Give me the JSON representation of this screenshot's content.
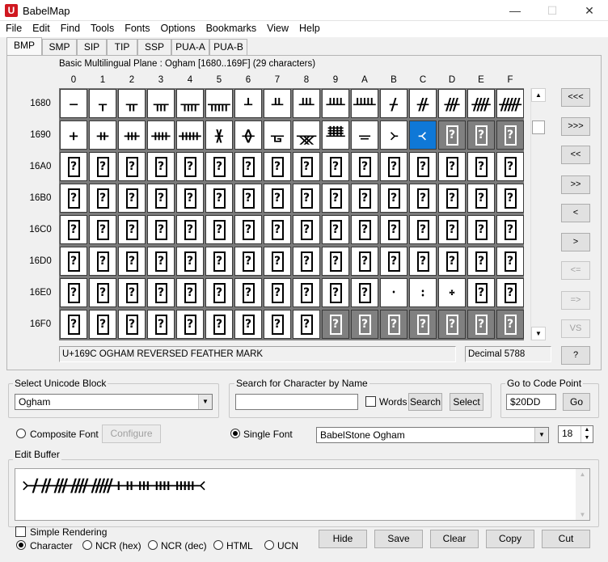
{
  "window": {
    "title": "BabelMap",
    "app_icon": "U",
    "controls": [
      "—",
      "☐",
      "✕"
    ]
  },
  "menu": [
    "File",
    "Edit",
    "Find",
    "Tools",
    "Fonts",
    "Options",
    "Bookmarks",
    "View",
    "Help"
  ],
  "tabs": [
    "BMP",
    "SMP",
    "SIP",
    "TIP",
    "SSP",
    "PUA-A",
    "PUA-B"
  ],
  "plane_label": "Basic Multilingual Plane : Ogham [1680..169F] (29 characters)",
  "column_headers": [
    "0",
    "1",
    "2",
    "3",
    "4",
    "5",
    "6",
    "7",
    "8",
    "9",
    "A",
    "B",
    "C",
    "D",
    "E",
    "F"
  ],
  "row_headers": [
    "1680",
    "1690",
    "16A0",
    "16B0",
    "16C0",
    "16D0",
    "16E0",
    "16F0"
  ],
  "rows": [
    [
      " ",
      "ᚁ",
      "ᚂ",
      "ᚃ",
      "ᚄ",
      "ᚅ",
      "ᚆ",
      "ᚇ",
      "ᚈ",
      "ᚉ",
      "ᚊ",
      "ᚋ",
      "ᚌ",
      "ᚍ",
      "ᚎ",
      "ᚏ"
    ],
    [
      "ᚐ",
      "ᚑ",
      "ᚒ",
      "ᚓ",
      "ᚔ",
      "ᚕ",
      "ᚖ",
      "ᚗ",
      "ᚘ",
      "ᚙ",
      "ᚚ",
      "᚛",
      "᚜",
      "?",
      "?",
      "?"
    ],
    [
      "?",
      "?",
      "?",
      "?",
      "?",
      "?",
      "?",
      "?",
      "?",
      "?",
      "?",
      "?",
      "?",
      "?",
      "?",
      "?"
    ],
    [
      "?",
      "?",
      "?",
      "?",
      "?",
      "?",
      "?",
      "?",
      "?",
      "?",
      "?",
      "?",
      "?",
      "?",
      "?",
      "?"
    ],
    [
      "?",
      "?",
      "?",
      "?",
      "?",
      "?",
      "?",
      "?",
      "?",
      "?",
      "?",
      "?",
      "?",
      "?",
      "?",
      "?"
    ],
    [
      "?",
      "?",
      "?",
      "?",
      "?",
      "?",
      "?",
      "?",
      "?",
      "?",
      "?",
      "?",
      "?",
      "?",
      "?",
      "?"
    ],
    [
      "?",
      "?",
      "?",
      "?",
      "?",
      "?",
      "?",
      "?",
      "?",
      "?",
      "?",
      "᛫",
      "᛬",
      "᛭",
      "?",
      "?"
    ],
    [
      "?",
      "?",
      "?",
      "?",
      "?",
      "?",
      "?",
      "?",
      "?",
      "?",
      "?",
      "?",
      "?",
      "?",
      "?",
      "?"
    ]
  ],
  "nav_buttons": [
    "<<<",
    ">>>",
    "<<",
    ">>",
    "<",
    ">",
    "<=",
    "=>",
    "VS",
    "?"
  ],
  "status": {
    "char_name": "U+169C OGHAM REVERSED FEATHER MARK",
    "decimal": "Decimal 5788"
  },
  "unicode_block": {
    "label": "Select Unicode Block",
    "value": "Ogham"
  },
  "search": {
    "label": "Search for Character by Name",
    "value": "",
    "words_label": "Words",
    "search_btn": "Search",
    "select_btn": "Select"
  },
  "goto": {
    "label": "Go to Code Point",
    "value": "$20DD",
    "go_btn": "Go"
  },
  "font": {
    "composite_label": "Composite Font",
    "configure_btn": "Configure",
    "single_label": "Single Font",
    "font_name": "BabelStone Ogham",
    "size": "18"
  },
  "edit_buffer": {
    "label": "Edit Buffer",
    "text": "᚛ᚋᚌᚍᚎᚏᚐᚑᚒᚓᚔ᚜"
  },
  "bottom": {
    "simple_rendering": "Simple Rendering",
    "modes": [
      "Character",
      "NCR (hex)",
      "NCR (dec)",
      "HTML",
      "UCN"
    ],
    "buttons": [
      "Hide",
      "Save",
      "Clear",
      "Copy",
      "Cut"
    ]
  }
}
